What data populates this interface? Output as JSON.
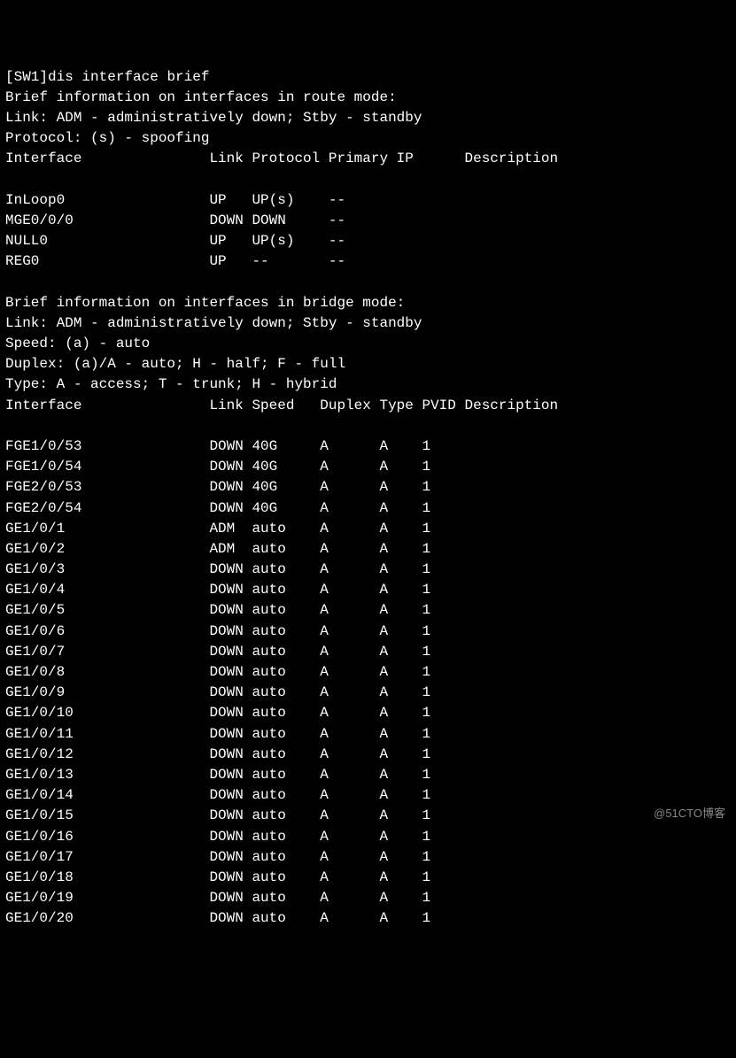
{
  "prompt_prefix": "[SW1]",
  "command": "dis interface brief",
  "route_section": {
    "heading": "Brief information on interfaces in route mode:",
    "legend_link": "Link: ADM - administratively down; Stby - standby",
    "legend_protocol": "Protocol: (s) - spoofing",
    "headers": [
      "Interface",
      "Link",
      "Protocol",
      "Primary IP",
      "Description"
    ],
    "rows": [
      {
        "iface": "InLoop0",
        "link": "UP",
        "proto": "UP(s)",
        "ip": "--",
        "desc": ""
      },
      {
        "iface": "MGE0/0/0",
        "link": "DOWN",
        "proto": "DOWN",
        "ip": "--",
        "desc": ""
      },
      {
        "iface": "NULL0",
        "link": "UP",
        "proto": "UP(s)",
        "ip": "--",
        "desc": ""
      },
      {
        "iface": "REG0",
        "link": "UP",
        "proto": "--",
        "ip": "--",
        "desc": ""
      }
    ]
  },
  "bridge_section": {
    "heading": "Brief information on interfaces in bridge mode:",
    "legend_link": "Link: ADM - administratively down; Stby - standby",
    "legend_speed": "Speed: (a) - auto",
    "legend_duplex": "Duplex: (a)/A - auto; H - half; F - full",
    "legend_type": "Type: A - access; T - trunk; H - hybrid",
    "headers": [
      "Interface",
      "Link",
      "Speed",
      "Duplex",
      "Type",
      "PVID",
      "Description"
    ],
    "rows": [
      {
        "iface": "FGE1/0/53",
        "link": "DOWN",
        "speed": "40G",
        "duplex": "A",
        "type": "A",
        "pvid": "1",
        "desc": ""
      },
      {
        "iface": "FGE1/0/54",
        "link": "DOWN",
        "speed": "40G",
        "duplex": "A",
        "type": "A",
        "pvid": "1",
        "desc": ""
      },
      {
        "iface": "FGE2/0/53",
        "link": "DOWN",
        "speed": "40G",
        "duplex": "A",
        "type": "A",
        "pvid": "1",
        "desc": ""
      },
      {
        "iface": "FGE2/0/54",
        "link": "DOWN",
        "speed": "40G",
        "duplex": "A",
        "type": "A",
        "pvid": "1",
        "desc": ""
      },
      {
        "iface": "GE1/0/1",
        "link": "ADM",
        "speed": "auto",
        "duplex": "A",
        "type": "A",
        "pvid": "1",
        "desc": ""
      },
      {
        "iface": "GE1/0/2",
        "link": "ADM",
        "speed": "auto",
        "duplex": "A",
        "type": "A",
        "pvid": "1",
        "desc": ""
      },
      {
        "iface": "GE1/0/3",
        "link": "DOWN",
        "speed": "auto",
        "duplex": "A",
        "type": "A",
        "pvid": "1",
        "desc": ""
      },
      {
        "iface": "GE1/0/4",
        "link": "DOWN",
        "speed": "auto",
        "duplex": "A",
        "type": "A",
        "pvid": "1",
        "desc": ""
      },
      {
        "iface": "GE1/0/5",
        "link": "DOWN",
        "speed": "auto",
        "duplex": "A",
        "type": "A",
        "pvid": "1",
        "desc": ""
      },
      {
        "iface": "GE1/0/6",
        "link": "DOWN",
        "speed": "auto",
        "duplex": "A",
        "type": "A",
        "pvid": "1",
        "desc": ""
      },
      {
        "iface": "GE1/0/7",
        "link": "DOWN",
        "speed": "auto",
        "duplex": "A",
        "type": "A",
        "pvid": "1",
        "desc": ""
      },
      {
        "iface": "GE1/0/8",
        "link": "DOWN",
        "speed": "auto",
        "duplex": "A",
        "type": "A",
        "pvid": "1",
        "desc": ""
      },
      {
        "iface": "GE1/0/9",
        "link": "DOWN",
        "speed": "auto",
        "duplex": "A",
        "type": "A",
        "pvid": "1",
        "desc": ""
      },
      {
        "iface": "GE1/0/10",
        "link": "DOWN",
        "speed": "auto",
        "duplex": "A",
        "type": "A",
        "pvid": "1",
        "desc": ""
      },
      {
        "iface": "GE1/0/11",
        "link": "DOWN",
        "speed": "auto",
        "duplex": "A",
        "type": "A",
        "pvid": "1",
        "desc": ""
      },
      {
        "iface": "GE1/0/12",
        "link": "DOWN",
        "speed": "auto",
        "duplex": "A",
        "type": "A",
        "pvid": "1",
        "desc": ""
      },
      {
        "iface": "GE1/0/13",
        "link": "DOWN",
        "speed": "auto",
        "duplex": "A",
        "type": "A",
        "pvid": "1",
        "desc": ""
      },
      {
        "iface": "GE1/0/14",
        "link": "DOWN",
        "speed": "auto",
        "duplex": "A",
        "type": "A",
        "pvid": "1",
        "desc": ""
      },
      {
        "iface": "GE1/0/15",
        "link": "DOWN",
        "speed": "auto",
        "duplex": "A",
        "type": "A",
        "pvid": "1",
        "desc": ""
      },
      {
        "iface": "GE1/0/16",
        "link": "DOWN",
        "speed": "auto",
        "duplex": "A",
        "type": "A",
        "pvid": "1",
        "desc": ""
      },
      {
        "iface": "GE1/0/17",
        "link": "DOWN",
        "speed": "auto",
        "duplex": "A",
        "type": "A",
        "pvid": "1",
        "desc": ""
      },
      {
        "iface": "GE1/0/18",
        "link": "DOWN",
        "speed": "auto",
        "duplex": "A",
        "type": "A",
        "pvid": "1",
        "desc": ""
      },
      {
        "iface": "GE1/0/19",
        "link": "DOWN",
        "speed": "auto",
        "duplex": "A",
        "type": "A",
        "pvid": "1",
        "desc": ""
      },
      {
        "iface": "GE1/0/20",
        "link": "DOWN",
        "speed": "auto",
        "duplex": "A",
        "type": "A",
        "pvid": "1",
        "desc": ""
      }
    ]
  },
  "watermark": "@51CTO博客"
}
